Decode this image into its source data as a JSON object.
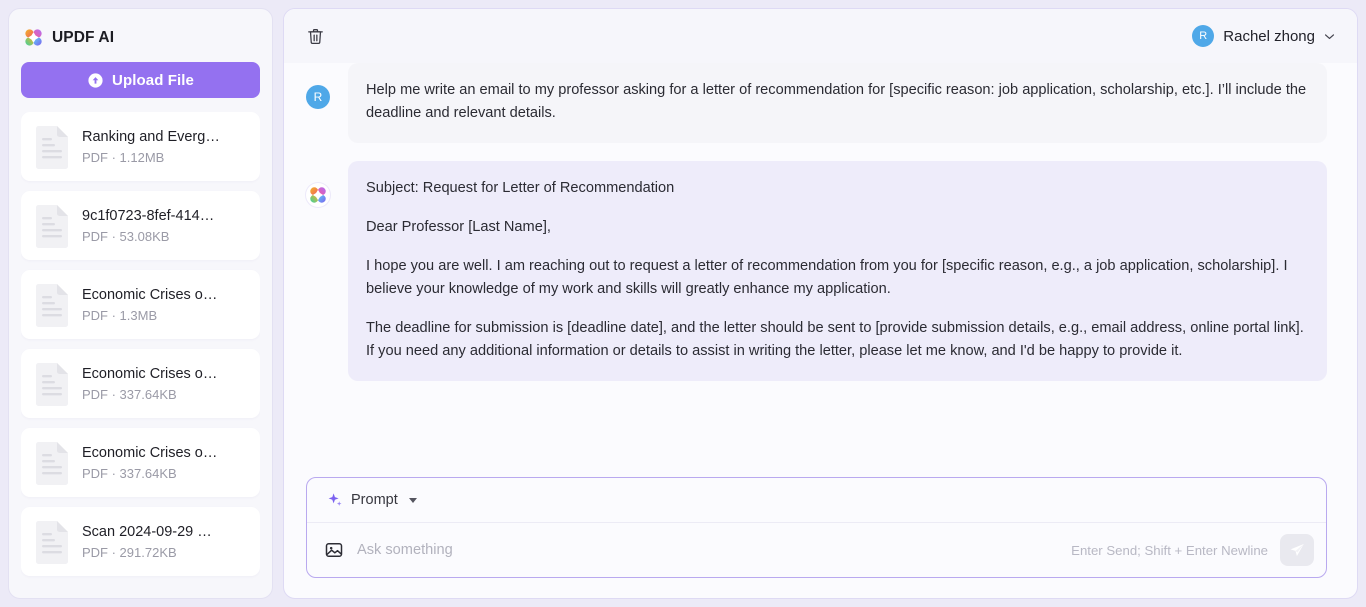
{
  "sidebar": {
    "brand": {
      "title": "UPDF AI",
      "logo_icon": "updf-flower-logo-icon"
    },
    "upload_button": {
      "label": "Upload File",
      "icon": "upload-arrow-icon"
    },
    "files": [
      {
        "name": "Ranking and Everg…",
        "sub": "PDF · 1.12MB",
        "icon": "pdf-document-icon"
      },
      {
        "name": "9c1f0723-8fef-414…",
        "sub": "PDF · 53.08KB",
        "icon": "pdf-document-icon"
      },
      {
        "name": "Economic Crises o…",
        "sub": "PDF · 1.3MB",
        "icon": "pdf-document-icon"
      },
      {
        "name": "Economic Crises o…",
        "sub": "PDF · 337.64KB",
        "icon": "pdf-document-icon"
      },
      {
        "name": "Economic Crises o…",
        "sub": "PDF · 337.64KB",
        "icon": "pdf-document-icon"
      },
      {
        "name": "Scan 2024-09-29 …",
        "sub": "PDF · 291.72KB",
        "icon": "pdf-document-icon"
      }
    ]
  },
  "topbar": {
    "trash_icon": "trash-icon",
    "user": {
      "name": "Rachel zhong",
      "avatar_initial": "R",
      "avatar_color": "#4fa8e8",
      "caret_icon": "chevron-down-icon"
    }
  },
  "chat": {
    "user_message": {
      "avatar_initial": "R",
      "text": "Help me write an email to my professor asking for a letter of recommendation for [specific reason: job application, scholarship, etc.]. I’ll include the deadline and relevant details."
    },
    "ai_message": {
      "avatar_icon": "updf-flower-logo-icon",
      "paragraphs": [
        "Subject: Request for Letter of Recommendation",
        "Dear Professor [Last Name],",
        "I hope you are well. I am reaching out to request a letter of recommendation from you for [specific reason, e.g., a job application, scholarship]. I believe your knowledge of my work and skills will greatly enhance my application.",
        "The deadline for submission is [deadline date], and the letter should be sent to [provide submission details, e.g., email address, online portal link]. If you need any additional information or details to assist in writing the letter, please let me know, and I'd be happy to provide it."
      ]
    }
  },
  "composer": {
    "prompt_button": {
      "label": "Prompt",
      "icon": "sparkle-icon",
      "caret_icon": "caret-down-icon"
    },
    "image_button_icon": "image-icon",
    "input": {
      "value": "",
      "placeholder": "Ask something"
    },
    "send_hint": "Enter Send; Shift + Enter Newline",
    "send_button_icon": "send-paper-plane-icon"
  },
  "colors": {
    "accent_purple": "#9471f0",
    "page_bg": "#eceaf7",
    "ai_bubble": "#eeecfa",
    "user_bubble": "#f5f5f9",
    "avatar_blue": "#4fa8e8"
  }
}
